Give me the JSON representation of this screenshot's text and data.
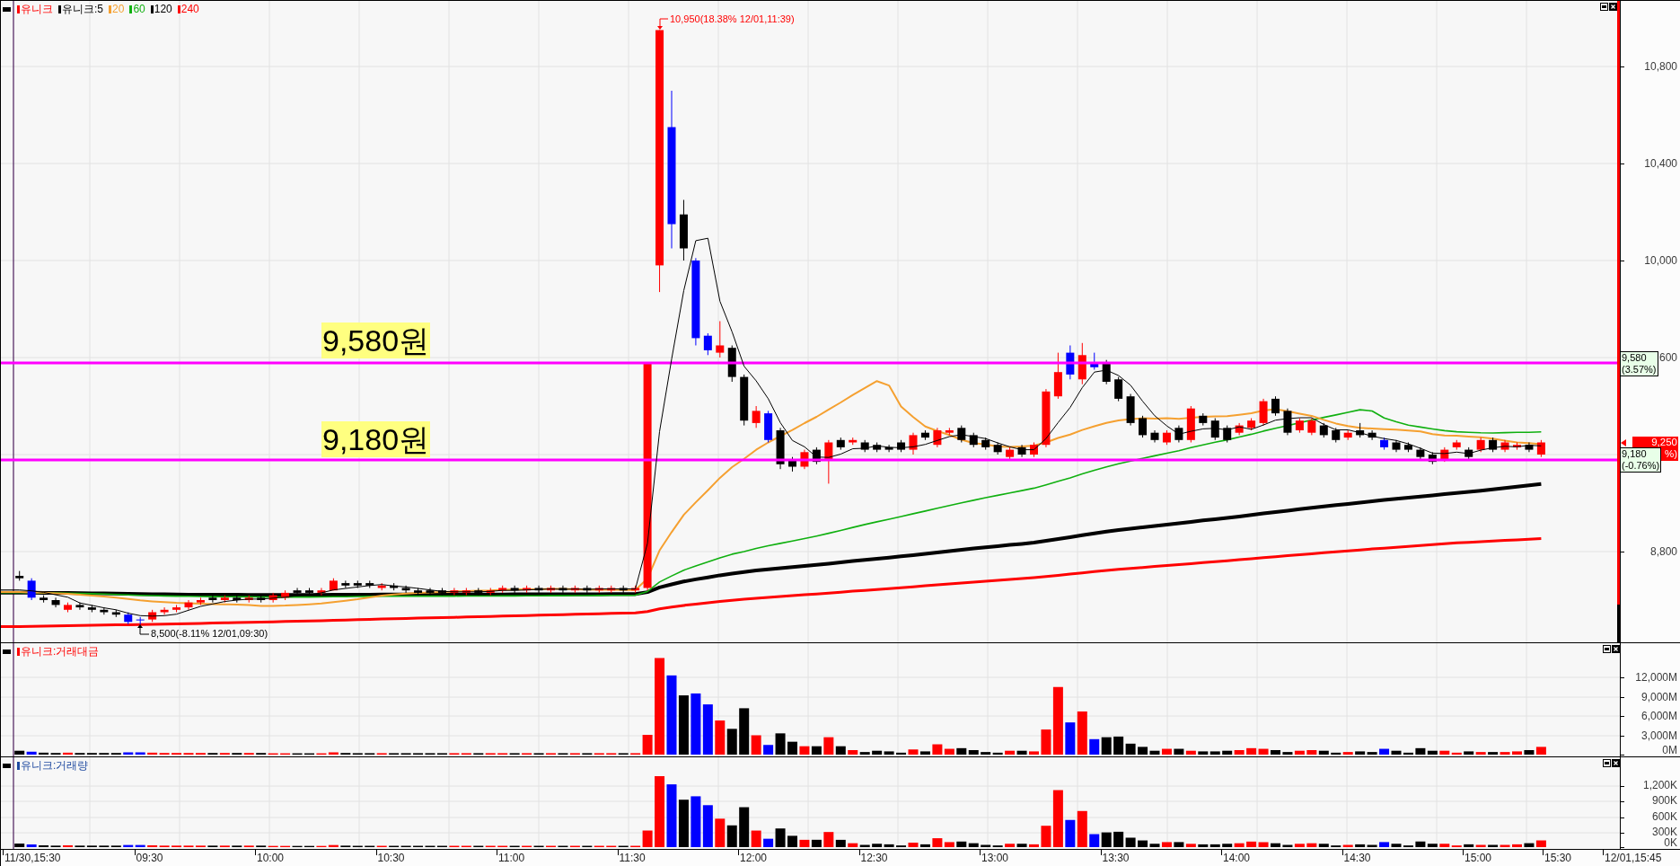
{
  "main_panel": {
    "legend": [
      {
        "label": "유니크",
        "color": "#ff0000"
      },
      {
        "label": "유니크:5",
        "color": "#000000"
      },
      {
        "label": "20",
        "color": "#f5a030"
      },
      {
        "label": "60",
        "color": "#10b010"
      },
      {
        "label": "120",
        "color": "#000000"
      },
      {
        "label": "240",
        "color": "#ff0000"
      }
    ],
    "high_note": "10,950(18.38% 12/01,11:39)",
    "low_note": "8,500(-8.11% 12/01,09:30)",
    "level_lines": [
      {
        "label": "9,580원",
        "marker": "9,580",
        "marker_change": "(3.57%)"
      },
      {
        "label": "9,180원",
        "marker": "9,180",
        "marker_change": "(-0.76%)"
      }
    ],
    "y_axis": [
      "10,800",
      "10,400",
      "10,000",
      "600",
      "8,800"
    ],
    "price_tag": {
      "price": "9,250",
      "change": "%)"
    }
  },
  "sub_panels": [
    {
      "kind": "trading_value",
      "title": "유니크:거래대금",
      "color": "#ff0000",
      "y_axis": [
        "12,000M",
        "9,000M",
        "6,000M",
        "3,000M",
        "0M"
      ]
    },
    {
      "kind": "trading_volume",
      "title": "유니크:거래량",
      "color": "#1f4aa0",
      "y_axis": [
        "1,200K",
        "900K",
        "600K",
        "300K",
        "0K"
      ]
    }
  ],
  "x_axis": [
    "11/30,15:30",
    "09:30",
    "10:00",
    "10:30",
    "11:00",
    "11:30",
    "12:00",
    "12:30",
    "13:00",
    "13:30",
    "14:00",
    "14:30",
    "15:00",
    "15:30",
    "12/01,15:45"
  ]
}
